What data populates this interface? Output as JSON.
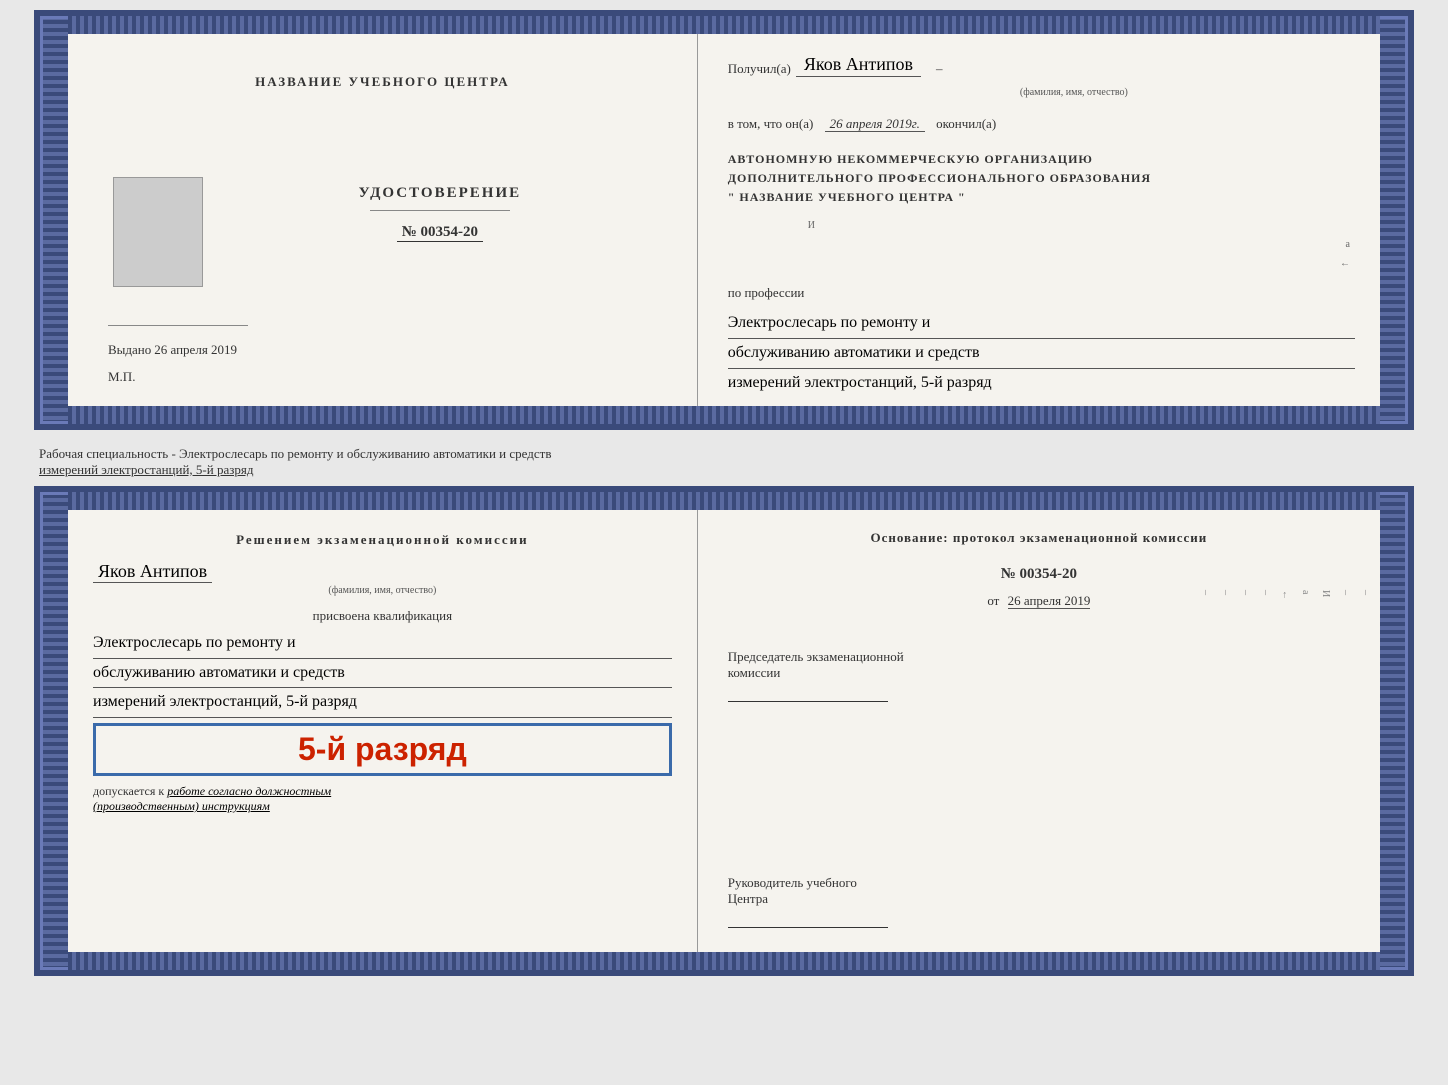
{
  "top_cert": {
    "left": {
      "org_title": "НАЗВАНИЕ УЧЕБНОГО ЦЕНТРА",
      "udostoverenie_label": "УДОСТОВЕРЕНИЕ",
      "number": "№ 00354-20",
      "vydano_label": "Выдано",
      "vydano_date": "26 апреля 2019",
      "mp_label": "М.П."
    },
    "right": {
      "poluchil_label": "Получил(а)",
      "recipient_name": "Яков Антипов",
      "fio_label": "(фамилия, имя, отчество)",
      "vtom_label": "в том, что он(а)",
      "completion_date": "26 апреля 2019г.",
      "okончил_label": "окончил(а)",
      "org_line1": "АВТОНОМНУЮ НЕКОММЕРЧЕСКУЮ ОРГАНИЗАЦИЮ",
      "org_line2": "ДОПОЛНИТЕЛЬНОГО ПРОФЕССИОНАЛЬНОГО ОБРАЗОВАНИЯ",
      "org_line3": "\"    НАЗВАНИЕ УЧЕБНОГО ЦЕНТРА    \"",
      "po_professii_label": "по профессии",
      "profession_line1": "Электрослесарь по ремонту и",
      "profession_line2": "обслуживанию автоматики и средств",
      "profession_line3": "измерений электростанций, 5-й разряд"
    }
  },
  "middle": {
    "text": "Рабочая специальность - Электрослесарь по ремонту и обслуживанию автоматики и средств",
    "text2": "измерений электростанций, 5-й разряд"
  },
  "bottom_cert": {
    "left": {
      "resheniem_title": "Решением  экзаменационной  комиссии",
      "recipient_name": "Яков Антипов",
      "fio_label": "(фамилия, имя, отчество)",
      "prisvoena_label": "присвоена квалификация",
      "qual_line1": "Электрослесарь по ремонту и",
      "qual_line2": "обслуживанию автоматики и средств",
      "qual_line3": "измерений электростанций, 5-й разряд",
      "razryad_badge": "5-й разряд",
      "dopuskaetsya_label": "допускается к",
      "dopuskaetsya_text": "работе согласно должностным",
      "instrukcii_text": "(производственным) инструкциям"
    },
    "right": {
      "osnovanie_label": "Основание:  протокол  экзаменационной  комиссии",
      "number": "№  00354-20",
      "ot_label": "от",
      "ot_date": "26 апреля 2019",
      "predsedatel_line1": "Председатель экзаменационной",
      "predsedatel_line2": "комиссии",
      "rukovoditel_line1": "Руководитель учебного",
      "rukovoditel_line2": "Центра"
    }
  }
}
